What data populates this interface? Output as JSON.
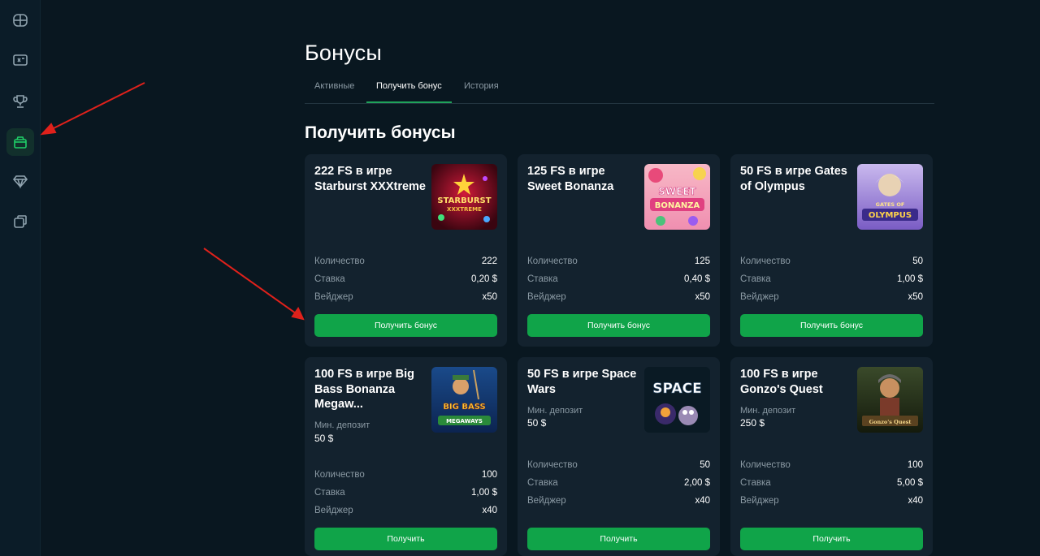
{
  "page": {
    "title": "Бонусы",
    "section_title": "Получить бонусы"
  },
  "tabs": [
    {
      "label": "Активные",
      "active": false
    },
    {
      "label": "Получить бонус",
      "active": true
    },
    {
      "label": "История",
      "active": false
    }
  ],
  "sidebar": {
    "items": [
      {
        "icon": "games-grid-icon",
        "active": false
      },
      {
        "icon": "ticket-icon",
        "active": false
      },
      {
        "icon": "trophy-icon",
        "active": false
      },
      {
        "icon": "gift-icon",
        "active": true
      },
      {
        "icon": "diamond-icon",
        "active": false
      },
      {
        "icon": "cards-icon",
        "active": false
      }
    ]
  },
  "colors": {
    "background": "#091720",
    "card": "#13222e",
    "accent": "#10a449",
    "muted_text": "#8b9aa4",
    "annotation_arrow": "#e0211b"
  },
  "bonuses": [
    {
      "title": "222 FS в игре Starburst XXXtreme",
      "image": "starburst-xxxtreme-thumbnail",
      "stats": [
        {
          "label": "Количество",
          "value": "222"
        },
        {
          "label": "Ставка",
          "value": "0,20 $"
        },
        {
          "label": "Вейджер",
          "value": "x50"
        }
      ],
      "button": "Получить бонус"
    },
    {
      "title": "125 FS в игре Sweet Bonanza",
      "image": "sweet-bonanza-thumbnail",
      "stats": [
        {
          "label": "Количество",
          "value": "125"
        },
        {
          "label": "Ставка",
          "value": "0,40 $"
        },
        {
          "label": "Вейджер",
          "value": "x50"
        }
      ],
      "button": "Получить бонус"
    },
    {
      "title": "50 FS в игре Gates of Olympus",
      "image": "gates-of-olympus-thumbnail",
      "stats": [
        {
          "label": "Количество",
          "value": "50"
        },
        {
          "label": "Ставка",
          "value": "1,00 $"
        },
        {
          "label": "Вейджер",
          "value": "x50"
        }
      ],
      "button": "Получить бонус"
    },
    {
      "title": "100 FS в игре Big Bass Bonanza Megaw...",
      "image": "big-bass-bonanza-megaways-thumbnail",
      "min_deposit_label": "Мин. депозит",
      "min_deposit": "50 $",
      "stats": [
        {
          "label": "Количество",
          "value": "100"
        },
        {
          "label": "Ставка",
          "value": "1,00 $"
        },
        {
          "label": "Вейджер",
          "value": "x40"
        }
      ],
      "button": "Получить"
    },
    {
      "title": "50 FS в игре Space Wars",
      "image": "space-wars-thumbnail",
      "min_deposit_label": "Мин. депозит",
      "min_deposit": "50 $",
      "stats": [
        {
          "label": "Количество",
          "value": "50"
        },
        {
          "label": "Ставка",
          "value": "2,00 $"
        },
        {
          "label": "Вейджер",
          "value": "x40"
        }
      ],
      "button": "Получить"
    },
    {
      "title": "100 FS в игре Gonzo's Quest",
      "image": "gonzos-quest-thumbnail",
      "min_deposit_label": "Мин. депозит",
      "min_deposit": "250 $",
      "stats": [
        {
          "label": "Количество",
          "value": "100"
        },
        {
          "label": "Ставка",
          "value": "5,00 $"
        },
        {
          "label": "Вейджер",
          "value": "x40"
        }
      ],
      "button": "Получить"
    }
  ],
  "thumb_text": {
    "starburst": "STARBURST",
    "xxxtreme": "XXXTREME",
    "sweet": "SWEET",
    "bonanza": "BONANZA",
    "gates": "GATES OF",
    "olympus": "OLYMPUS",
    "bigbass": "BIG BASS",
    "megaways": "MEGAWAYS",
    "space": "SPACE",
    "gonzo": "Gonzo's Quest"
  }
}
